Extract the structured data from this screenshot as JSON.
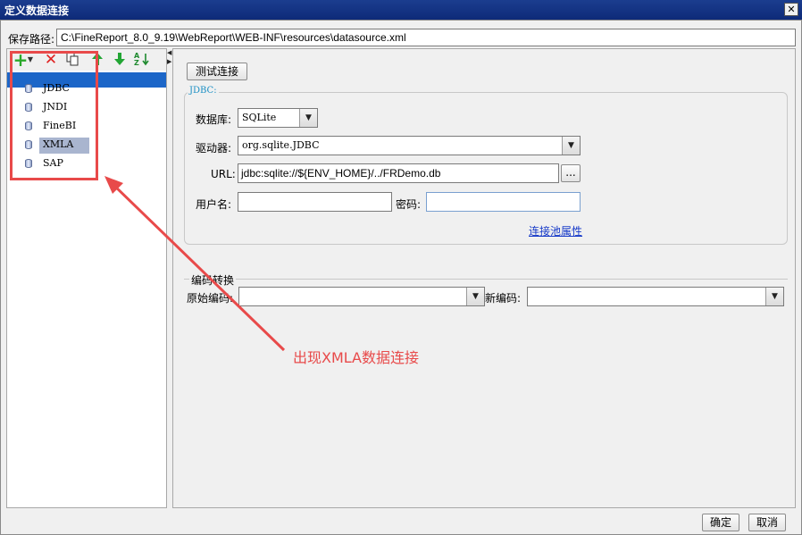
{
  "window": {
    "title": "定义数据连接",
    "close_glyph": "✕"
  },
  "save_path": {
    "label": "保存路径:",
    "value": "C:\\FineReport_8.0_9.19\\WebReport\\WEB-INF\\resources\\datasource.xml"
  },
  "toolbar": {
    "add_icon": "plus-icon",
    "delete_icon": "delete-icon",
    "copy_icon": "copy-icon",
    "up_icon": "move-up-icon",
    "down_icon": "move-down-icon",
    "sort_icon": "sort-icon"
  },
  "tree": {
    "items": [
      {
        "label": "JDBC"
      },
      {
        "label": "JNDI"
      },
      {
        "label": "FineBI"
      },
      {
        "label": "XMLA"
      },
      {
        "label": "SAP"
      }
    ]
  },
  "main": {
    "test_button": "测试连接",
    "group_title": "JDBC:",
    "database_label": "数据库:",
    "database_value": "SQLite",
    "driver_label": "驱动器:",
    "driver_value": "org.sqlite.JDBC",
    "url_label": "URL:",
    "url_value": "jdbc:sqlite://${ENV_HOME}/../FRDemo.db",
    "url_browse": "...",
    "user_label": "用户名:",
    "user_value": "",
    "password_label": "密码:",
    "password_value": "",
    "pool_link": "连接池属性",
    "encoding_title": "编码转换",
    "orig_encoding_label": "原始编码:",
    "orig_encoding_value": "",
    "new_encoding_label": "新编码:",
    "new_encoding_value": ""
  },
  "footer": {
    "ok": "确定",
    "cancel": "取消"
  },
  "annotation": {
    "text": "出现XMLA数据连接",
    "color": "#e84a4a"
  }
}
